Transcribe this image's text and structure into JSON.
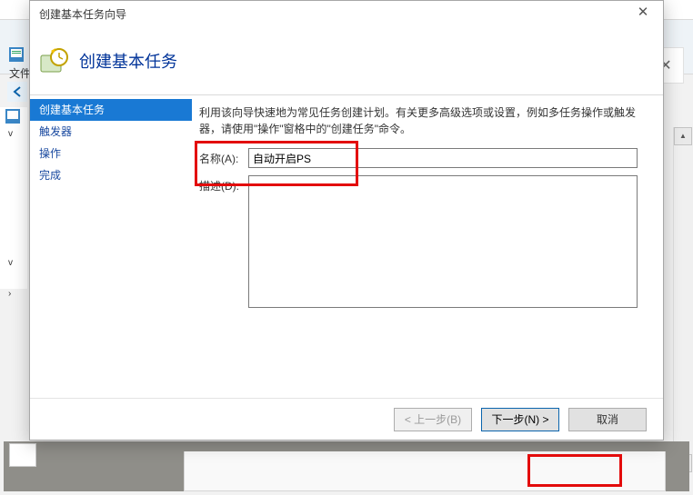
{
  "background": {
    "toolbar_label": "文件",
    "close_x": "✕"
  },
  "dialog": {
    "window_title": "创建基本任务向导",
    "header_title": "创建基本任务",
    "close_label": "✕",
    "steps": {
      "s1": "创建基本任务",
      "s2": "触发器",
      "s3": "操作",
      "s4": "完成"
    },
    "intro": "利用该向导快速地为常见任务创建计划。有关更多高级选项或设置，例如多任务操作或触发器，请使用\"操作\"窗格中的\"创建任务\"命令。",
    "name_label": "名称(A):",
    "name_value": "自动开启PS",
    "desc_label": "描述(D):",
    "desc_value": "",
    "buttons": {
      "back": "< 上一步(B)",
      "next": "下一步(N) >",
      "cancel": "取消"
    }
  }
}
